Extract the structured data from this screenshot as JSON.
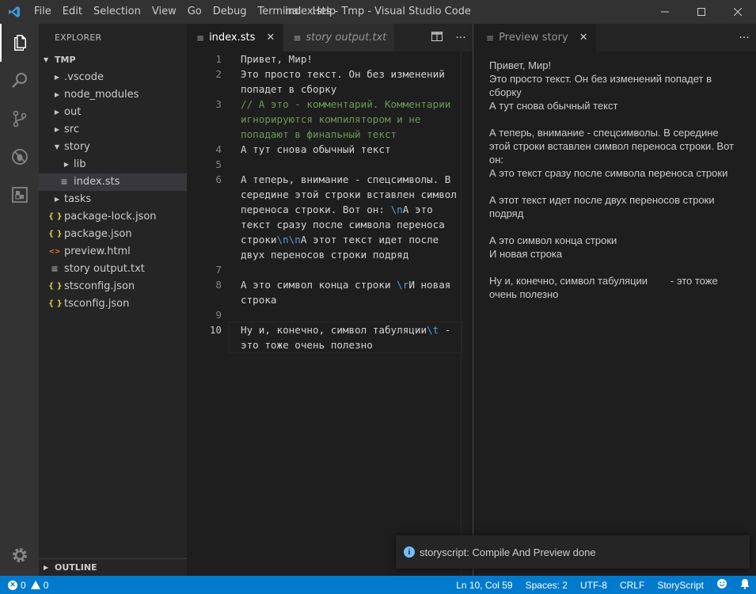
{
  "titlebar": {
    "menu": [
      "File",
      "Edit",
      "Selection",
      "View",
      "Go",
      "Debug",
      "Terminal",
      "Help"
    ],
    "window_title": "index.sts - Tmp - Visual Studio Code"
  },
  "activity_bar": {
    "icons": [
      "files-icon",
      "search-icon",
      "source-control-icon",
      "debug-icon",
      "extensions-icon"
    ],
    "bottom_icon": "gear-icon"
  },
  "sidebar": {
    "title": "EXPLORER",
    "root": "TMP",
    "items": [
      {
        "label": ".vscode",
        "type": "folder",
        "depth": 1,
        "expanded": false
      },
      {
        "label": "node_modules",
        "type": "folder",
        "depth": 1,
        "expanded": false
      },
      {
        "label": "out",
        "type": "folder",
        "depth": 1,
        "expanded": false
      },
      {
        "label": "src",
        "type": "folder",
        "depth": 1,
        "expanded": false
      },
      {
        "label": "story",
        "type": "folder",
        "depth": 1,
        "expanded": true
      },
      {
        "label": "lib",
        "type": "folder",
        "depth": 2,
        "expanded": false
      },
      {
        "label": "index.sts",
        "type": "file",
        "depth": 2,
        "selected": true
      },
      {
        "label": "tasks",
        "type": "folder",
        "depth": 1,
        "expanded": false
      },
      {
        "label": "package-lock.json",
        "type": "json",
        "depth": 1
      },
      {
        "label": "package.json",
        "type": "json",
        "depth": 1
      },
      {
        "label": "preview.html",
        "type": "html",
        "depth": 1
      },
      {
        "label": "story output.txt",
        "type": "txt",
        "depth": 1
      },
      {
        "label": "stsconfig.json",
        "type": "json",
        "depth": 1
      },
      {
        "label": "tsconfig.json",
        "type": "json",
        "depth": 1
      }
    ],
    "outline_label": "OUTLINE"
  },
  "editor": {
    "tabs": [
      {
        "label": "index.sts",
        "active": true,
        "italic": false
      },
      {
        "label": "story output.txt",
        "active": false,
        "italic": true
      }
    ],
    "lines": [
      {
        "number": "1",
        "segments": [
          {
            "text": "Привет, Мир!",
            "kind": "text"
          }
        ]
      },
      {
        "number": "2",
        "segments": [
          {
            "text": "Это просто текст. Он без изменений попадет в сборку",
            "kind": "text"
          }
        ]
      },
      {
        "number": "3",
        "segments": [
          {
            "text": "// А это - комментарий. Комментарии игнорируются компилятором и не попадают в финальный текст",
            "kind": "comment"
          }
        ]
      },
      {
        "number": "4",
        "segments": [
          {
            "text": "А тут снова обычный текст",
            "kind": "text"
          }
        ]
      },
      {
        "number": "5",
        "segments": []
      },
      {
        "number": "6",
        "segments": [
          {
            "text": "А теперь, внимание - спецсимволы. В середине этой строки вставлен символ переноса строки. Вот он: ",
            "kind": "text"
          },
          {
            "text": "\\n",
            "kind": "escape"
          },
          {
            "text": "А это текст сразу после символа переноса строки",
            "kind": "text"
          },
          {
            "text": "\\n\\n",
            "kind": "escape"
          },
          {
            "text": "А этот текст идет после двух переносов строки подряд",
            "kind": "text"
          }
        ]
      },
      {
        "number": "7",
        "segments": []
      },
      {
        "number": "8",
        "segments": [
          {
            "text": "А это символ конца строки ",
            "kind": "text"
          },
          {
            "text": "\\r",
            "kind": "escape"
          },
          {
            "text": "И новая строка",
            "kind": "text"
          }
        ]
      },
      {
        "number": "9",
        "segments": []
      },
      {
        "number": "10",
        "current": true,
        "segments": [
          {
            "text": "Ну и, конечно, символ табуляции",
            "kind": "text"
          },
          {
            "text": "\\t",
            "kind": "escape"
          },
          {
            "text": " - это тоже очень полезно",
            "kind": "text"
          }
        ]
      }
    ]
  },
  "preview": {
    "tab_label": "Preview story",
    "paragraphs": [
      [
        "Привет, Мир!",
        "Это просто текст. Он без изменений попадет в сборку",
        "А тут снова обычный текст"
      ],
      [
        "А теперь, внимание - спецсимволы. В середине этой строки вставлен символ переноса строки. Вот он:",
        "А это текст сразу после символа переноса строки"
      ],
      [
        "А этот текст идет после двух переносов строки подряд"
      ],
      [
        "А это символ конца строки",
        "И новая строка"
      ],
      [
        "Ну и, конечно, символ табуляции        - это тоже очень полезно"
      ]
    ]
  },
  "notification": {
    "text": "storyscript: Compile And Preview done"
  },
  "statusbar": {
    "errors": "0",
    "warnings": "0",
    "position": "Ln 10, Col 59",
    "spaces": "Spaces: 2",
    "encoding": "UTF-8",
    "eol": "CRLF",
    "language": "StoryScript"
  },
  "colors": {
    "statusbar": "#007acc",
    "comment": "#6a9955",
    "escape": "#569cd6",
    "json_icon": "#cbcb41",
    "html_icon": "#e37933",
    "vscode_logo": "#3c99d4"
  }
}
